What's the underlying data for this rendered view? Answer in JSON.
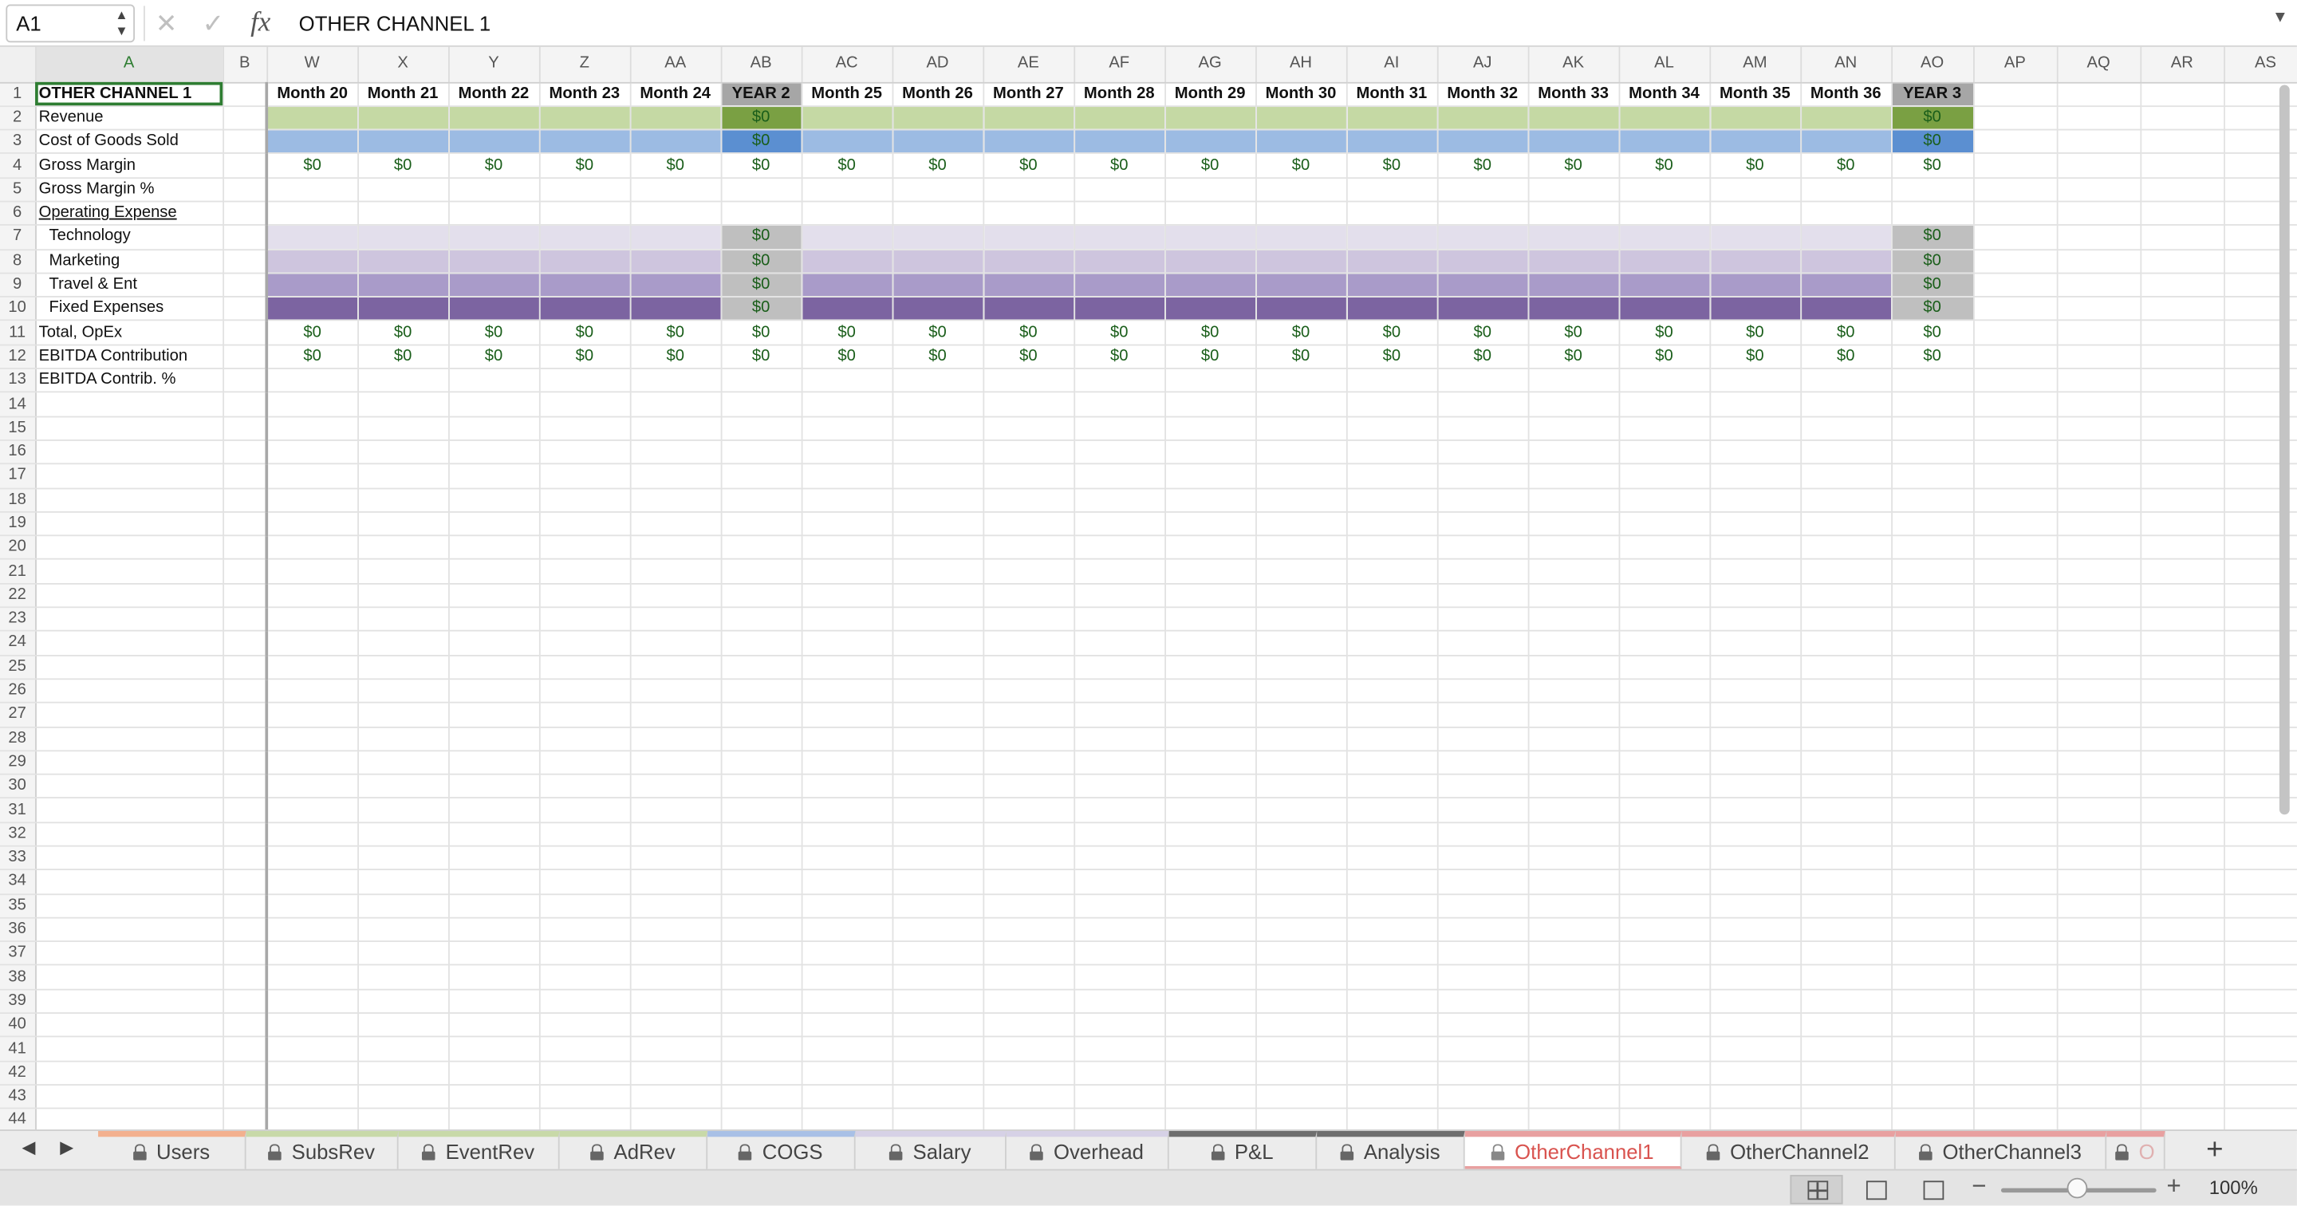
{
  "formula_bar": {
    "cell_ref": "A1",
    "formula": "OTHER CHANNEL 1",
    "fx": "fx",
    "cancel": "✕",
    "confirm": "✓"
  },
  "columns": [
    "A",
    "B",
    "W",
    "X",
    "Y",
    "Z",
    "AA",
    "AB",
    "AC",
    "AD",
    "AE",
    "AF",
    "AG",
    "AH",
    "AI",
    "AJ",
    "AK",
    "AL",
    "AM",
    "AN",
    "AO",
    "AP",
    "AQ",
    "AR",
    "AS"
  ],
  "headers": [
    "OTHER CHANNEL 1",
    "",
    "Month 20",
    "Month 21",
    "Month 22",
    "Month 23",
    "Month 24",
    "YEAR 2",
    "Month 25",
    "Month 26",
    "Month 27",
    "Month 28",
    "Month 29",
    "Month 30",
    "Month 31",
    "Month 32",
    "Month 33",
    "Month 34",
    "Month 35",
    "Month 36",
    "YEAR 3",
    "",
    "",
    "",
    ""
  ],
  "row_labels": [
    "Revenue",
    "Cost of Goods Sold",
    "Gross Margin",
    "Gross Margin %",
    "Operating Expense",
    "Technology",
    "Marketing",
    "Travel & Ent",
    "Fixed Expenses",
    "Total, OpEx",
    "EBITDA Contribution",
    "EBITDA Contrib. %"
  ],
  "value_text": "$0",
  "row_colors": {
    "Revenue": "#c5d9a4",
    "Cost of Goods Sold": "#9cbbe3",
    "Technology": "#e3dfec",
    "Marketing": "#cec5de",
    "Travel & Ent": "#a99bc9",
    "Fixed Expenses": "#7c64a1"
  },
  "year_colors": {
    "Revenue": "#7aa043",
    "Cost of Goods Sold": "#5b8fd1"
  },
  "total_rows": 44,
  "sheet_tabs": [
    {
      "name": "Users",
      "color": "#f3b08e",
      "locked": true
    },
    {
      "name": "SubsRev",
      "color": "#c8d9a8",
      "locked": true
    },
    {
      "name": "EventRev",
      "color": "#c8d9a8",
      "locked": true
    },
    {
      "name": "AdRev",
      "color": "#c8d9a8",
      "locked": true
    },
    {
      "name": "COGS",
      "color": "#a8c0e6",
      "locked": true
    },
    {
      "name": "Salary",
      "color": "#d6d1e6",
      "locked": true
    },
    {
      "name": "Overhead",
      "color": "#d6d1e6",
      "locked": true
    },
    {
      "name": "P&L",
      "color": "#6e6e6e",
      "locked": true
    },
    {
      "name": "Analysis",
      "color": "#6e6e6e",
      "locked": true
    },
    {
      "name": "OtherChannel1",
      "color": "#e8a0a0",
      "locked": true,
      "active": true
    },
    {
      "name": "OtherChannel2",
      "color": "#e8a0a0",
      "locked": true
    },
    {
      "name": "OtherChannel3",
      "color": "#e8a0a0",
      "locked": true
    },
    {
      "name": "O",
      "color": "#e8a0a0",
      "locked": true
    }
  ],
  "nav": {
    "left": "◀",
    "right": "▶",
    "add": "+"
  },
  "status": {
    "zoom": "100%",
    "minus": "−",
    "plus": "+"
  }
}
